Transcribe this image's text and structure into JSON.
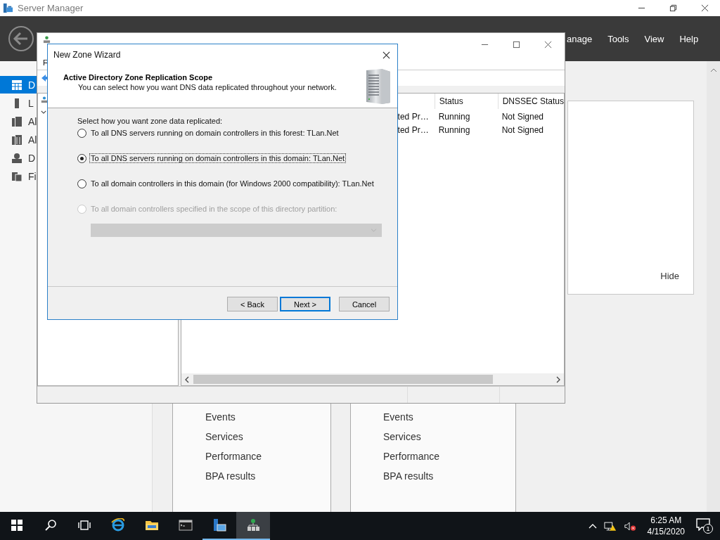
{
  "server_manager": {
    "title": "Server Manager",
    "menu": [
      "anage",
      "Tools",
      "View",
      "Help"
    ],
    "sidebar": [
      {
        "kind": "dashboard",
        "label": "D",
        "selected": true
      },
      {
        "kind": "server",
        "label": "L",
        "selected": false
      },
      {
        "kind": "servers",
        "label": "Al",
        "selected": false
      },
      {
        "kind": "roles",
        "label": "Al",
        "selected": false
      },
      {
        "kind": "dns",
        "label": "D",
        "selected": false
      },
      {
        "kind": "files",
        "label": "Fi",
        "selected": false
      }
    ],
    "hide_link": "Hide",
    "tiles": [
      {
        "items": [
          "Events",
          "Services",
          "Performance",
          "BPA results"
        ]
      },
      {
        "items": [
          "Events",
          "Services",
          "Performance",
          "BPA results"
        ]
      }
    ]
  },
  "dns_manager": {
    "menu": [
      "F"
    ],
    "columns": [
      "Status",
      "DNSSEC Status"
    ],
    "rows": [
      {
        "column_1": "ted Pr…",
        "status": "Running",
        "dnssec": "Not Signed"
      },
      {
        "column_1": "ted Pr…",
        "status": "Running",
        "dnssec": "Not Signed"
      }
    ]
  },
  "wizard": {
    "title": "New Zone Wizard",
    "heading": "Active Directory Zone Replication Scope",
    "description": "You can select how you want DNS data replicated throughout your network.",
    "prompt": "Select how you want zone data replicated:",
    "options": [
      {
        "label": "To all DNS servers running on domain controllers in this forest: TLan.Net",
        "selected": false,
        "disabled": false
      },
      {
        "label": "To all DNS servers running on domain controllers in this domain: TLan.Net",
        "selected": true,
        "disabled": false
      },
      {
        "label": "To all domain controllers in this domain (for Windows 2000 compatibility): TLan.Net",
        "selected": false,
        "disabled": false
      },
      {
        "label": "To all domain controllers specified in the scope of this directory partition:",
        "selected": false,
        "disabled": true
      }
    ],
    "dropdown": {
      "disabled": true
    },
    "buttons": [
      {
        "label": "< Back",
        "default": false
      },
      {
        "label": "Next >",
        "default": true
      },
      {
        "label": "Cancel",
        "default": false
      }
    ]
  },
  "taskbar": {
    "items": [
      {
        "kind": "start",
        "running": false,
        "active": false
      },
      {
        "kind": "search",
        "running": false,
        "active": false
      },
      {
        "kind": "task-view",
        "running": false,
        "active": false
      },
      {
        "kind": "browser",
        "running": false,
        "active": false
      },
      {
        "kind": "folder",
        "running": false,
        "active": false
      },
      {
        "kind": "terminal",
        "running": false,
        "active": false
      },
      {
        "kind": "server-manager",
        "running": true,
        "active": false
      },
      {
        "kind": "dns",
        "running": true,
        "active": true
      }
    ],
    "time": "6:25 AM",
    "date": "4/15/2020",
    "notifications": "1"
  }
}
